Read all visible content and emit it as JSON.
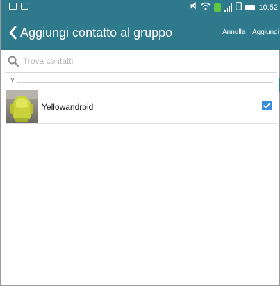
{
  "status_bar": {
    "time": "10:52",
    "icons": [
      "gallery-icon",
      "message-icon",
      "mute-icon",
      "wifi-icon",
      "sim-icon",
      "signal-icon",
      "battery-icon"
    ],
    "color": "#2e7a8c"
  },
  "app_bar": {
    "back_icon": "chevron-left-icon",
    "title": "Aggiungi contatto al gruppo",
    "cancel_label": "Annulla",
    "add_label": "Aggiungi",
    "color": "#2e7a8c"
  },
  "search": {
    "placeholder": "Trova contatti",
    "value": "",
    "icon": "search-icon"
  },
  "contacts": {
    "sections": [
      {
        "letter": "Y",
        "items": [
          {
            "name": "Yellowandroid",
            "checked": true,
            "avatar": "yellow-android-photo"
          }
        ]
      }
    ]
  },
  "colors": {
    "accent": "#2e7a8c",
    "checkbox": "#3b8fd9"
  }
}
